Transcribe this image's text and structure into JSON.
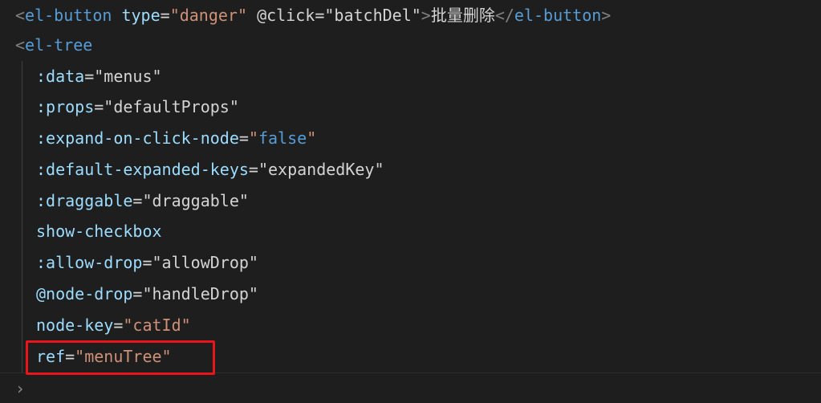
{
  "editor": {
    "lines": [
      {
        "tokens": [
          {
            "t": "tag_open",
            "v": "<"
          },
          {
            "t": "tag",
            "v": "el-button"
          },
          {
            "t": "space",
            "v": " "
          },
          {
            "t": "attr",
            "v": "type"
          },
          {
            "t": "eq",
            "v": "="
          },
          {
            "t": "str",
            "v": "\"danger\""
          },
          {
            "t": "space",
            "v": " "
          },
          {
            "t": "attr2",
            "v": "@click"
          },
          {
            "t": "eq",
            "v": "="
          },
          {
            "t": "str2",
            "v": "\"batchDel\""
          },
          {
            "t": "tag_close",
            "v": ">"
          },
          {
            "t": "text",
            "v": "批量删除"
          },
          {
            "t": "tag_open",
            "v": "</"
          },
          {
            "t": "tag",
            "v": "el-button"
          },
          {
            "t": "tag_close",
            "v": ">"
          }
        ]
      },
      {
        "tokens": [
          {
            "t": "tag_open",
            "v": "<"
          },
          {
            "t": "tag",
            "v": "el-tree"
          }
        ]
      },
      {
        "tokens": [
          {
            "t": "attr",
            "v": ":data"
          },
          {
            "t": "eq",
            "v": "="
          },
          {
            "t": "str2",
            "v": "\"menus\""
          }
        ]
      },
      {
        "tokens": [
          {
            "t": "attr",
            "v": ":props"
          },
          {
            "t": "eq",
            "v": "="
          },
          {
            "t": "str2",
            "v": "\"defaultProps\""
          }
        ]
      },
      {
        "tokens": [
          {
            "t": "attr",
            "v": ":expand-on-click-node"
          },
          {
            "t": "eq",
            "v": "="
          },
          {
            "t": "q",
            "v": "\""
          },
          {
            "t": "kw",
            "v": "false"
          },
          {
            "t": "q",
            "v": "\""
          }
        ]
      },
      {
        "tokens": [
          {
            "t": "attr",
            "v": ":default-expanded-keys"
          },
          {
            "t": "eq",
            "v": "="
          },
          {
            "t": "str2",
            "v": "\"expandedKey\""
          }
        ]
      },
      {
        "tokens": [
          {
            "t": "attr",
            "v": ":draggable"
          },
          {
            "t": "eq",
            "v": "="
          },
          {
            "t": "str2",
            "v": "\"draggable\""
          }
        ]
      },
      {
        "tokens": [
          {
            "t": "attr",
            "v": "show-checkbox"
          }
        ]
      },
      {
        "tokens": [
          {
            "t": "attr",
            "v": ":allow-drop"
          },
          {
            "t": "eq",
            "v": "="
          },
          {
            "t": "str2",
            "v": "\"allowDrop\""
          }
        ]
      },
      {
        "tokens": [
          {
            "t": "attr",
            "v": "@node-drop"
          },
          {
            "t": "eq",
            "v": "="
          },
          {
            "t": "str2",
            "v": "\"handleDrop\""
          }
        ]
      },
      {
        "tokens": [
          {
            "t": "attr",
            "v": "node-key"
          },
          {
            "t": "eq",
            "v": "="
          },
          {
            "t": "str",
            "v": "\"catId\""
          }
        ]
      },
      {
        "tokens": [
          {
            "t": "attr",
            "v": "ref"
          },
          {
            "t": "eq",
            "v": "="
          },
          {
            "t": "str",
            "v": "\"menuTree\""
          }
        ]
      }
    ],
    "fold_chevron": "›"
  },
  "colors": {
    "background": "#1e1e1e",
    "tag": "#569cd6",
    "punct": "#808080",
    "attr": "#9cdcfe",
    "string": "#ce9178",
    "keyword": "#569cd6",
    "highlight_box": "#e8161b"
  }
}
